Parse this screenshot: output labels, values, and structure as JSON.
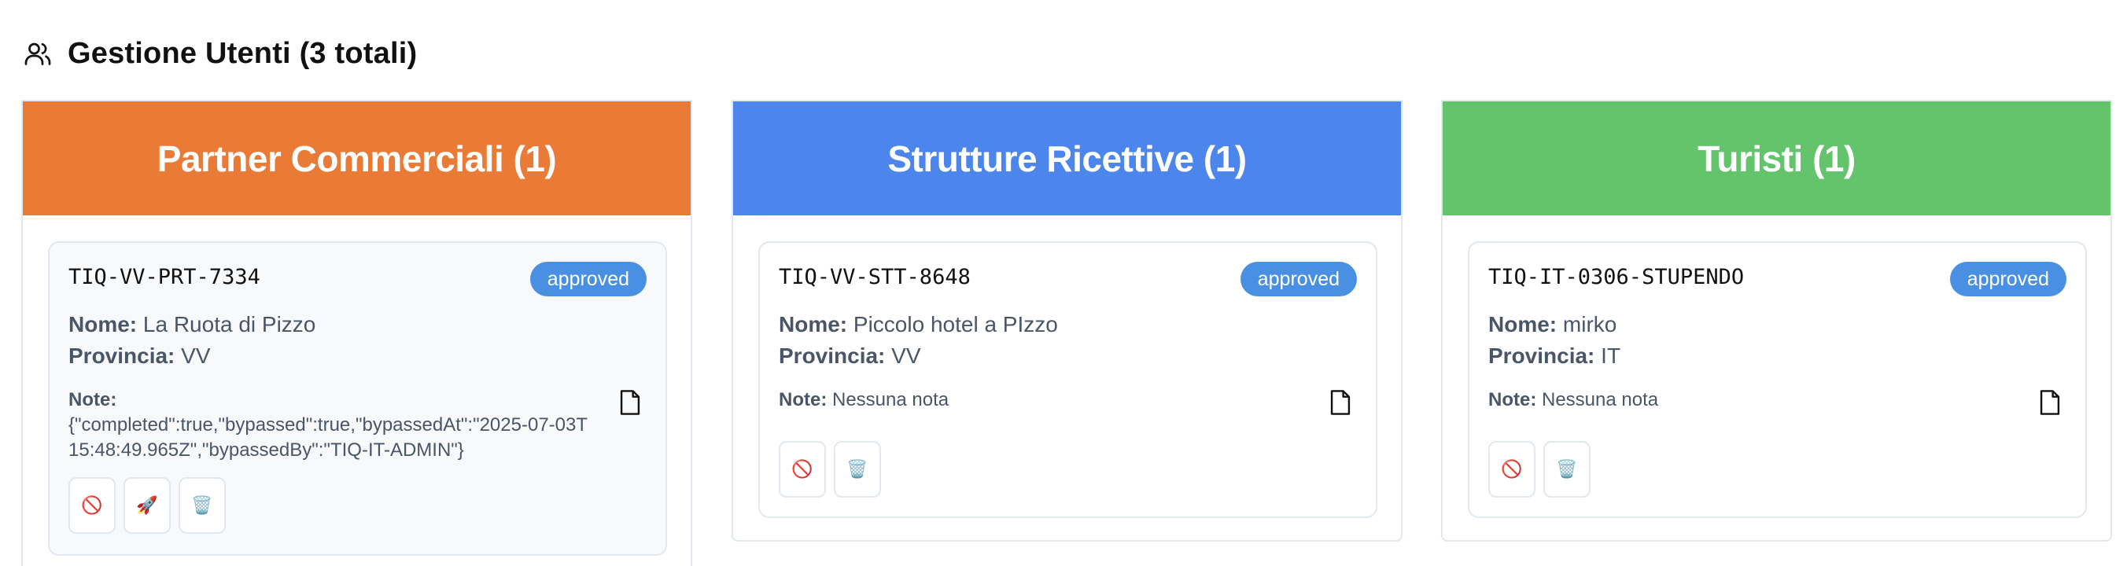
{
  "header": {
    "title": "Gestione Utenti (3 totali)",
    "icon": "users-icon"
  },
  "labels": {
    "nome": "Nome:",
    "provincia": "Provincia:",
    "note": "Note:"
  },
  "columns": [
    {
      "title": "Partner Commerciali (1)",
      "color": "#ea7b37",
      "card": {
        "code": "TIQ-VV-PRT-7334",
        "status": "approved",
        "nome": "La Ruota di Pizzo",
        "provincia": "VV",
        "note": "{\"completed\":true,\"bypassed\":true,\"bypassedAt\":\"2025-07-03T15:48:49.965Z\",\"bypassedBy\":\"TIQ-IT-ADMIN\"}",
        "actions": [
          {
            "label": "🚫",
            "icon": "block-icon"
          },
          {
            "label": "🚀",
            "icon": "rocket-icon"
          },
          {
            "label": "🗑️",
            "icon": "trash-icon"
          }
        ]
      }
    },
    {
      "title": "Strutture Ricettive (1)",
      "color": "#4c86ec",
      "card": {
        "code": "TIQ-VV-STT-8648",
        "status": "approved",
        "nome": "Piccolo hotel a PIzzo",
        "provincia": "VV",
        "note": "Nessuna nota",
        "actions": [
          {
            "label": "🚫",
            "icon": "block-icon"
          },
          {
            "label": "🗑️",
            "icon": "trash-icon"
          }
        ]
      }
    },
    {
      "title": "Turisti (1)",
      "color": "#63c46b",
      "card": {
        "code": "TIQ-IT-0306-STUPENDO",
        "status": "approved",
        "nome": "mirko",
        "provincia": "IT",
        "note": "Nessuna nota",
        "actions": [
          {
            "label": "🚫",
            "icon": "block-icon"
          },
          {
            "label": "🗑️",
            "icon": "trash-icon"
          }
        ]
      }
    }
  ]
}
